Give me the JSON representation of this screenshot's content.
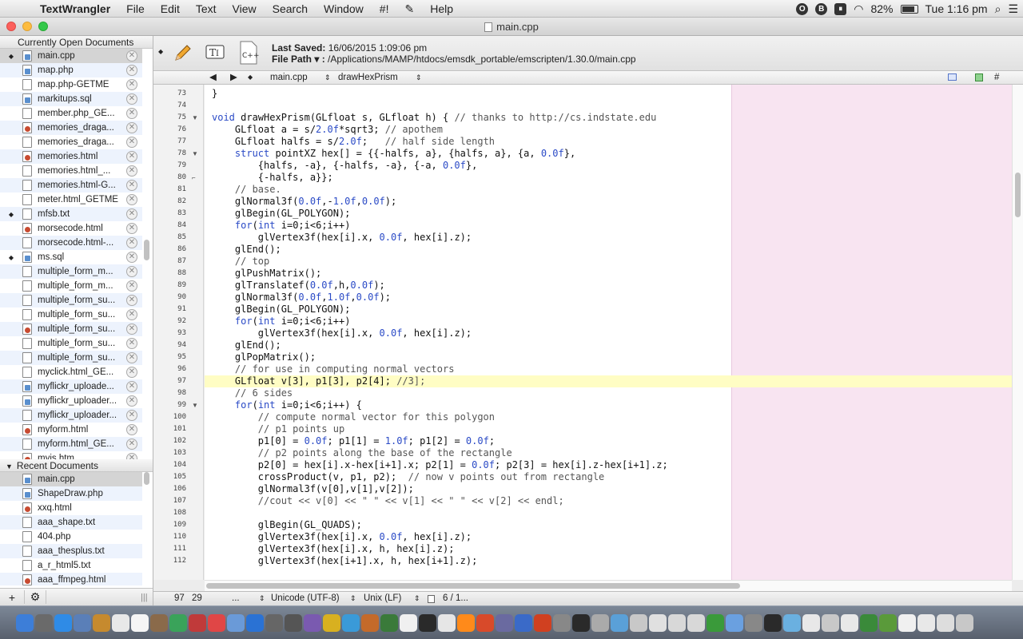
{
  "menubar": {
    "app_name": "TextWrangler",
    "items": [
      "File",
      "Edit",
      "Text",
      "View",
      "Search",
      "Window",
      "#!",
      "Help"
    ],
    "battery": "82%",
    "clock": "Tue 1:16 pm"
  },
  "window": {
    "title": "main.cpp"
  },
  "sidebar": {
    "open_header": "Currently Open Documents",
    "open_docs": [
      {
        "name": "main.cpp",
        "dirty": true,
        "icon": "cpp-file-icon"
      },
      {
        "name": "map.php",
        "dirty": false,
        "icon": "php-file-icon"
      },
      {
        "name": "map.php-GETME",
        "dirty": false,
        "icon": "generic-file-icon"
      },
      {
        "name": "markitups.sql",
        "dirty": false,
        "icon": "sql-file-icon"
      },
      {
        "name": "member.php_GE...",
        "dirty": false,
        "icon": "generic-file-icon"
      },
      {
        "name": "memories_draga...",
        "dirty": false,
        "icon": "html-file-icon"
      },
      {
        "name": "memories_draga...",
        "dirty": false,
        "icon": "generic-file-icon"
      },
      {
        "name": "memories.html",
        "dirty": false,
        "icon": "html-file-icon"
      },
      {
        "name": "memories.html_...",
        "dirty": false,
        "icon": "generic-file-icon"
      },
      {
        "name": "memories.html-G...",
        "dirty": false,
        "icon": "generic-file-icon"
      },
      {
        "name": "meter.html_GETME",
        "dirty": false,
        "icon": "generic-file-icon"
      },
      {
        "name": "mfsb.txt",
        "dirty": true,
        "icon": "generic-file-icon"
      },
      {
        "name": "morsecode.html",
        "dirty": false,
        "icon": "html-file-icon"
      },
      {
        "name": "morsecode.html-...",
        "dirty": false,
        "icon": "generic-file-icon"
      },
      {
        "name": "ms.sql",
        "dirty": true,
        "icon": "sql-file-icon"
      },
      {
        "name": "multiple_form_m...",
        "dirty": false,
        "icon": "generic-file-icon"
      },
      {
        "name": "multiple_form_m...",
        "dirty": false,
        "icon": "generic-file-icon"
      },
      {
        "name": "multiple_form_su...",
        "dirty": false,
        "icon": "generic-file-icon"
      },
      {
        "name": "multiple_form_su...",
        "dirty": false,
        "icon": "generic-file-icon"
      },
      {
        "name": "multiple_form_su...",
        "dirty": false,
        "icon": "html-file-icon"
      },
      {
        "name": "multiple_form_su...",
        "dirty": false,
        "icon": "generic-file-icon"
      },
      {
        "name": "multiple_form_su...",
        "dirty": false,
        "icon": "generic-file-icon"
      },
      {
        "name": "myclick.html_GE...",
        "dirty": false,
        "icon": "generic-file-icon"
      },
      {
        "name": "myflickr_uploade...",
        "dirty": false,
        "icon": "php-file-icon"
      },
      {
        "name": "myflickr_uploader...",
        "dirty": false,
        "icon": "php-file-icon"
      },
      {
        "name": "myflickr_uploader...",
        "dirty": false,
        "icon": "generic-file-icon"
      },
      {
        "name": "myform.html",
        "dirty": false,
        "icon": "html-file-icon"
      },
      {
        "name": "myform.html_GE...",
        "dirty": false,
        "icon": "generic-file-icon"
      },
      {
        "name": "myjs.htm",
        "dirty": false,
        "icon": "html-file-icon"
      }
    ],
    "recent_header": "Recent Documents",
    "recent_docs": [
      {
        "name": "main.cpp",
        "icon": "cpp-file-icon"
      },
      {
        "name": "ShapeDraw.php",
        "icon": "php-file-icon"
      },
      {
        "name": "xxq.html",
        "icon": "html-file-icon"
      },
      {
        "name": "aaa_shape.txt",
        "icon": "generic-file-icon"
      },
      {
        "name": "404.php",
        "icon": "generic-file-icon"
      },
      {
        "name": "aaa_thesplus.txt",
        "icon": "generic-file-icon"
      },
      {
        "name": "a_r_html5.txt",
        "icon": "generic-file-icon"
      },
      {
        "name": "aaa_ffmpeg.html",
        "icon": "html-file-icon"
      }
    ],
    "add_label": "+",
    "gear_label": "⚙"
  },
  "toolbar": {
    "last_saved_label": "Last Saved:",
    "last_saved_value": "16/06/2015 1:09:06 pm",
    "file_path_label": "File Path ▾ :",
    "file_path_value": "/Applications/MAMP/htdocs/emsdk_portable/emscripten/1.30.0/main.cpp"
  },
  "navbar": {
    "file_menu": "main.cpp",
    "function_menu": "drawHexPrism",
    "hash_label": "#"
  },
  "editor": {
    "highlight_line": 97,
    "lines": [
      {
        "n": 73,
        "t": "}"
      },
      {
        "n": 74,
        "t": ""
      },
      {
        "n": 75,
        "t": "void drawHexPrism(GLfloat s, GLfloat h) { // thanks to http://cs.indstate.edu",
        "fold": "▼"
      },
      {
        "n": 76,
        "t": "    GLfloat a = s/2.0f*sqrt3; // apothem"
      },
      {
        "n": 77,
        "t": "    GLfloat halfs = s/2.0f;   // half side length"
      },
      {
        "n": 78,
        "t": "    struct pointXZ hex[] = {{-halfs, a}, {halfs, a}, {a, 0.0f},",
        "fold": "▼"
      },
      {
        "n": 79,
        "t": "        {halfs, -a}, {-halfs, -a}, {-a, 0.0f},"
      },
      {
        "n": 80,
        "t": "        {-halfs, a}};",
        "fold": "⌐"
      },
      {
        "n": 81,
        "t": "    // base."
      },
      {
        "n": 82,
        "t": "    glNormal3f(0.0f,-1.0f,0.0f);"
      },
      {
        "n": 83,
        "t": "    glBegin(GL_POLYGON);"
      },
      {
        "n": 84,
        "t": "    for(int i=0;i<6;i++)"
      },
      {
        "n": 85,
        "t": "        glVertex3f(hex[i].x, 0.0f, hex[i].z);"
      },
      {
        "n": 86,
        "t": "    glEnd();"
      },
      {
        "n": 87,
        "t": "    // top"
      },
      {
        "n": 88,
        "t": "    glPushMatrix();"
      },
      {
        "n": 89,
        "t": "    glTranslatef(0.0f,h,0.0f);"
      },
      {
        "n": 90,
        "t": "    glNormal3f(0.0f,1.0f,0.0f);"
      },
      {
        "n": 91,
        "t": "    glBegin(GL_POLYGON);"
      },
      {
        "n": 92,
        "t": "    for(int i=0;i<6;i++)"
      },
      {
        "n": 93,
        "t": "        glVertex3f(hex[i].x, 0.0f, hex[i].z);"
      },
      {
        "n": 94,
        "t": "    glEnd();"
      },
      {
        "n": 95,
        "t": "    glPopMatrix();"
      },
      {
        "n": 96,
        "t": "    // for use in computing normal vectors"
      },
      {
        "n": 97,
        "t": "    GLfloat v[3], p1[3], p2[4]; //3];"
      },
      {
        "n": 98,
        "t": "    // 6 sides"
      },
      {
        "n": 99,
        "t": "    for(int i=0;i<6;i++) {",
        "fold": "▼"
      },
      {
        "n": 100,
        "t": "        // compute normal vector for this polygon"
      },
      {
        "n": 101,
        "t": "        // p1 points up"
      },
      {
        "n": 102,
        "t": "        p1[0] = 0.0f; p1[1] = 1.0f; p1[2] = 0.0f;"
      },
      {
        "n": 103,
        "t": "        // p2 points along the base of the rectangle"
      },
      {
        "n": 104,
        "t": "        p2[0] = hex[i].x-hex[i+1].x; p2[1] = 0.0f; p2[3] = hex[i].z-hex[i+1].z;"
      },
      {
        "n": 105,
        "t": "        crossProduct(v, p1, p2);  // now v points out from rectangle"
      },
      {
        "n": 106,
        "t": "        glNormal3f(v[0],v[1],v[2]);"
      },
      {
        "n": 107,
        "t": "        //cout << v[0] << \" \" << v[1] << \" \" << v[2] << endl;"
      },
      {
        "n": 108,
        "t": ""
      },
      {
        "n": 109,
        "t": "        glBegin(GL_QUADS);"
      },
      {
        "n": 110,
        "t": "        glVertex3f(hex[i].x, 0.0f, hex[i].z);"
      },
      {
        "n": 111,
        "t": "        glVertex3f(hex[i].x, h, hex[i].z);"
      },
      {
        "n": 112,
        "t": "        glVertex3f(hex[i+1].x, h, hex[i+1].z);"
      }
    ]
  },
  "status": {
    "line": "97",
    "column": "29",
    "ellipsis": "...",
    "encoding": "Unicode (UTF-8)",
    "line_endings": "Unix (LF)",
    "doc_count": "6 / 1..."
  },
  "colors": {
    "keyword": "#2a4ac6",
    "highlight": "#fffdc4",
    "selection": "#b5d5ff",
    "margin": "#f8e4f1"
  }
}
